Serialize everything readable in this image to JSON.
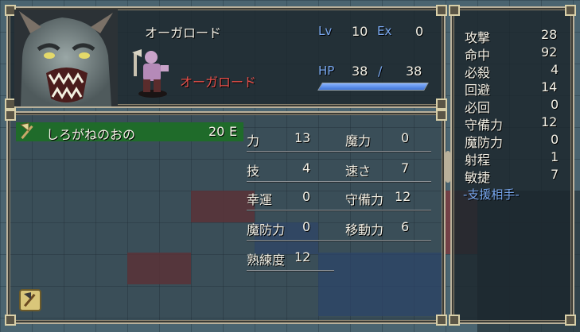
{
  "unit": {
    "name": "オーガロード",
    "class": "オーガロード",
    "lv_label": "Lv",
    "lv": "10",
    "ex_label": "Ex",
    "ex": "0",
    "hp_label": "HP",
    "hp_current": "38",
    "hp_sep": "/",
    "hp_max": "38",
    "hp_fraction": 1.0
  },
  "weapon": {
    "name": "しろがねのおの",
    "uses": "20",
    "equipped_mark": "E",
    "icon": "axe-icon"
  },
  "stats": [
    {
      "label": "力",
      "value": "13"
    },
    {
      "label": "魔力",
      "value": "0"
    },
    {
      "label": "技",
      "value": "4"
    },
    {
      "label": "速さ",
      "value": "7"
    },
    {
      "label": "幸運",
      "value": "0"
    },
    {
      "label": "守備力",
      "value": "12"
    },
    {
      "label": "魔防力",
      "value": "0"
    },
    {
      "label": "移動力",
      "value": "6"
    },
    {
      "label": "熟練度",
      "value": "12"
    }
  ],
  "combat": [
    {
      "label": "攻撃",
      "value": "28"
    },
    {
      "label": "命中",
      "value": "92"
    },
    {
      "label": "必殺",
      "value": "4"
    },
    {
      "label": "回避",
      "value": "14"
    },
    {
      "label": "必回",
      "value": "0"
    },
    {
      "label": "守備力",
      "value": "12"
    },
    {
      "label": "魔防力",
      "value": "0"
    },
    {
      "label": "射程",
      "value": "1"
    },
    {
      "label": "敏捷",
      "value": "7"
    }
  ],
  "support_label": "-支援相手-",
  "colors": {
    "weapon_bar": "#1f6b2a",
    "hp_bar": "#3f74d8",
    "accent_blue": "#79a8f0",
    "class_red": "#e8504a",
    "frame": "#b9b09a"
  }
}
